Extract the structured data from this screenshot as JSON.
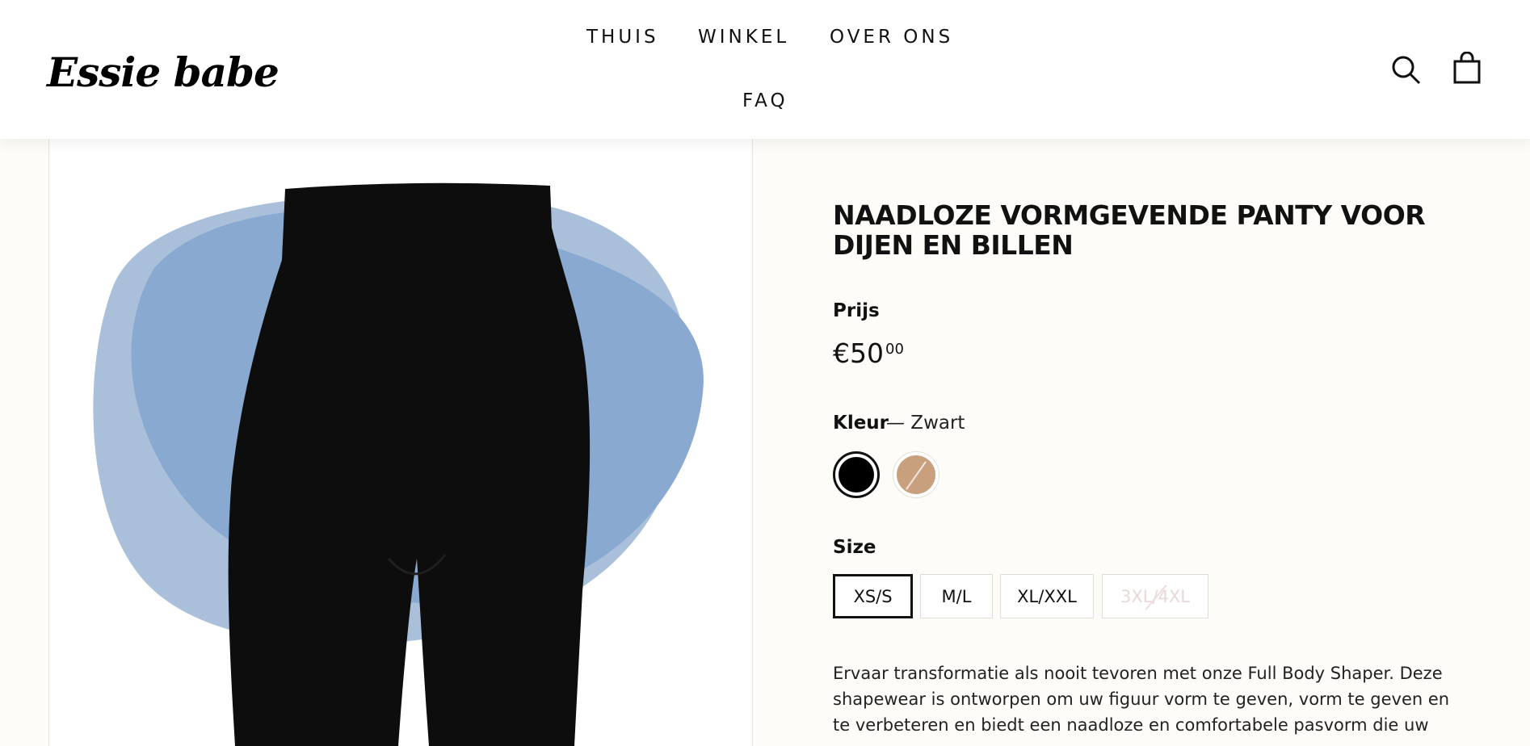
{
  "header": {
    "logo": "Essie babe",
    "nav": [
      "THUIS",
      "WINKEL",
      "OVER ONS",
      "FAQ"
    ],
    "icons": [
      "search-icon",
      "shopping-bag-icon"
    ]
  },
  "product": {
    "title": "NAADLOZE VORMGEVENDE PANTY VOOR DIJEN EN BILLEN",
    "price_label": "Prijs",
    "price_main": "€50",
    "price_cents": "00",
    "color_label": "Kleur",
    "color_value": "— Zwart",
    "colors": [
      {
        "name": "Zwart",
        "hex": "#000000",
        "selected": true
      },
      {
        "name": "Nude",
        "hex": "#c9a07e",
        "selected": false
      }
    ],
    "size_label": "Size",
    "sizes": [
      {
        "label": "XS/S",
        "state": "selected"
      },
      {
        "label": "M/L",
        "state": "available"
      },
      {
        "label": "XL/XXL",
        "state": "available"
      },
      {
        "label": "3XL/4XL",
        "state": "sold-out"
      }
    ],
    "description": "Ervaar transformatie als nooit tevoren met onze Full Body Shaper. Deze shapewear is ontworpen om uw figuur vorm te geven, vorm te geven en te verbeteren en biedt een naadloze en comfortabele pasvorm die uw"
  },
  "colors": {
    "background": "#fdfcf8",
    "blob_light": "#a9bfda",
    "blob_dark": "#8aa9d0",
    "garment": "#0d0d0d"
  }
}
